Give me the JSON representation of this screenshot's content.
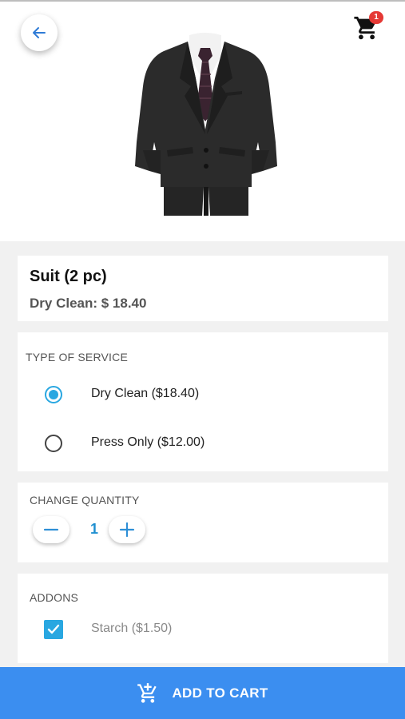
{
  "header": {
    "back_icon": "arrow-left-icon",
    "cart_icon": "shopping-cart-icon",
    "cart_badge": "1"
  },
  "product": {
    "image": "suit-image",
    "title": "Suit (2 pc)",
    "price_line": "Dry Clean: $ 18.40"
  },
  "service": {
    "label": "TYPE OF SERVICE",
    "options": [
      {
        "label": "Dry Clean ($18.40)",
        "selected": true
      },
      {
        "label": "Press Only ($12.00)",
        "selected": false
      }
    ]
  },
  "quantity": {
    "label": "CHANGE QUANTITY",
    "value": "1",
    "decrement_icon": "minus-icon",
    "increment_icon": "plus-icon"
  },
  "addons": {
    "label": "ADDONS",
    "items": [
      {
        "label": "Starch  ($1.50)",
        "checked": true
      }
    ]
  },
  "footer": {
    "add_to_cart_label": "ADD TO CART",
    "add_to_cart_icon": "add-shopping-cart-icon"
  },
  "colors": {
    "accent": "#29a7e1",
    "primary_button": "#3b8ef0",
    "badge": "#e53935",
    "quantity_text": "#1e8fd0"
  }
}
